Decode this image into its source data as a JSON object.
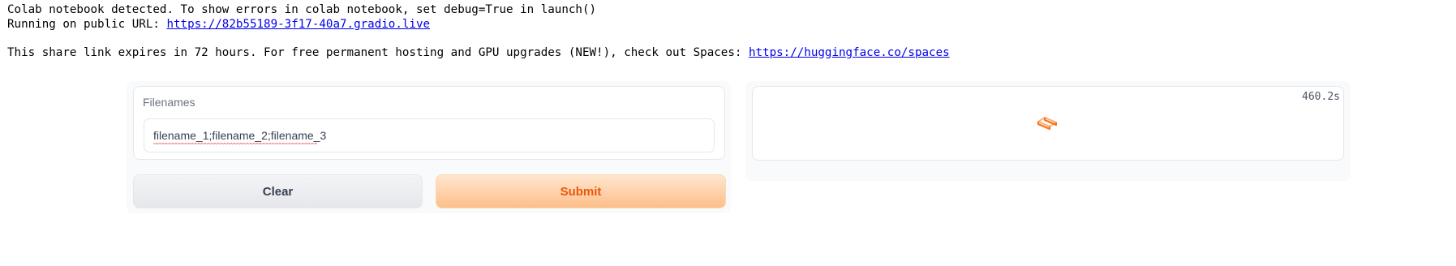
{
  "console": {
    "line1": "Colab notebook detected. To show errors in colab notebook, set debug=True in launch()",
    "line2_prefix": "Running on public URL: ",
    "public_url": "https://82b55189-3f17-40a7.gradio.live",
    "line3_prefix": "This share link expires in 72 hours. For free permanent hosting and GPU upgrades (NEW!), check out Spaces: ",
    "spaces_url": "https://huggingface.co/spaces"
  },
  "input": {
    "label": "Filenames",
    "value": "filename_1;filename_2;filename_3"
  },
  "buttons": {
    "clear": "Clear",
    "submit": "Submit"
  },
  "output": {
    "timer": "460.2s",
    "loader_icon": "loading-spinner-icon"
  },
  "colors": {
    "accent": "#f97316",
    "submit_text": "#ea580c",
    "link": "#0000ee"
  }
}
